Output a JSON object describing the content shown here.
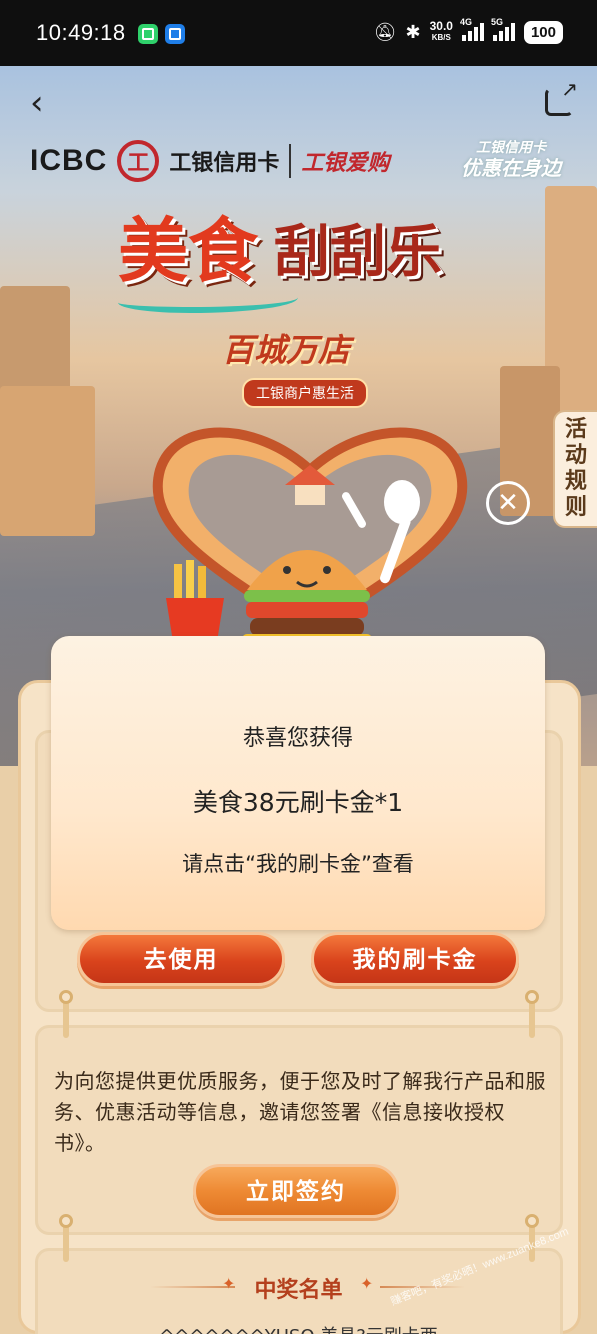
{
  "status_bar": {
    "time": "10:49:18",
    "speed": "30.0",
    "speed_unit": "KB/S",
    "net1": "4G",
    "net2": "5G",
    "battery": "100"
  },
  "brand": {
    "icbc": "ICBC",
    "seal": "工",
    "card_name": "工银信用卡",
    "aigou": "工银爱购",
    "badge_line1": "工银信用卡",
    "badge_line2": "优惠在身边"
  },
  "hero": {
    "title_a": "美食",
    "title_b": "刮刮乐",
    "subtitle": "百城万店",
    "pill": "工银商户惠生活",
    "rules_tab": "活动规则"
  },
  "dialog": {
    "line1": "恭喜您获得",
    "line2": "美食38元刷卡金*1",
    "line3": "请点击“我的刷卡金”查看",
    "close": "✕"
  },
  "buttons": {
    "use": "去使用",
    "my_card": "我的刷卡金",
    "sign": "立即签约"
  },
  "auth": {
    "text": "为向您提供更优质服务，便于您及时了解我行产品和服务、优惠活动等信息，邀请您签署《信息接收授权书》。"
  },
  "winners": {
    "title": "中奖名单",
    "row": "^^^^^^^YUSO 美具?元刷卡西"
  },
  "watermark": "赚客吧，有奖必晒！www.zuanke8.com",
  "colors": {
    "accent": "#d9431c",
    "panel": "#f6e3c7",
    "brand_red": "#c1272d"
  }
}
